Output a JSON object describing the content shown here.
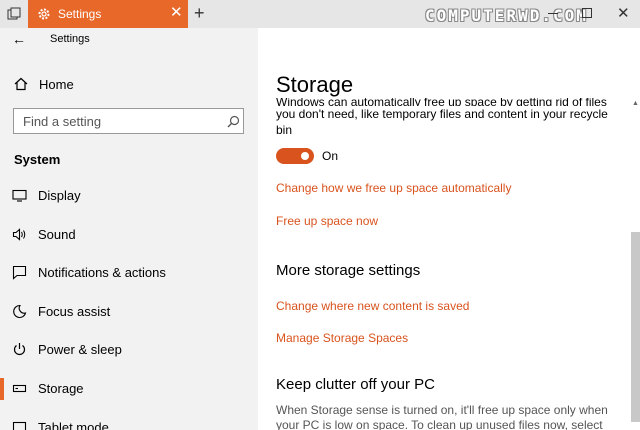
{
  "tab": {
    "title": "Settings",
    "close": "✕",
    "new_tab": "+"
  },
  "watermark": "COMPUTERWD.COM",
  "window": {
    "close": "✕"
  },
  "sidebar": {
    "back": "←",
    "app_title": "Settings",
    "home": "Home",
    "search_placeholder": "Find a setting",
    "section": "System",
    "items": [
      {
        "label": "Display",
        "icon": "display-icon"
      },
      {
        "label": "Sound",
        "icon": "sound-icon"
      },
      {
        "label": "Notifications & actions",
        "icon": "notifications-icon"
      },
      {
        "label": "Focus assist",
        "icon": "moon-icon"
      },
      {
        "label": "Power & sleep",
        "icon": "power-icon"
      },
      {
        "label": "Storage",
        "icon": "storage-icon",
        "selected": true
      },
      {
        "label": "Tablet mode",
        "icon": "tablet-icon"
      }
    ]
  },
  "main": {
    "title": "Storage",
    "desc_line0": "Windows can automatically free up space by getting rid of files",
    "desc_rest": "you don't need, like temporary files and content in your recycle bin",
    "toggle_label": "On",
    "toggle_on": true,
    "link_change_free": "Change how we free up space automatically",
    "link_free_now": "Free up space now",
    "more_heading": "More storage settings",
    "link_content_saved": "Change where new content is saved",
    "link_storage_spaces": "Manage Storage Spaces",
    "clutter_heading": "Keep clutter off your PC",
    "clutter_desc": "When Storage sense is turned on, it'll free up space only when your PC is low on space. To clean up unused files now, select"
  },
  "colors": {
    "accent": "#e8682a",
    "link": "#d9531e",
    "sidebar_bg": "#f2f2f2"
  }
}
